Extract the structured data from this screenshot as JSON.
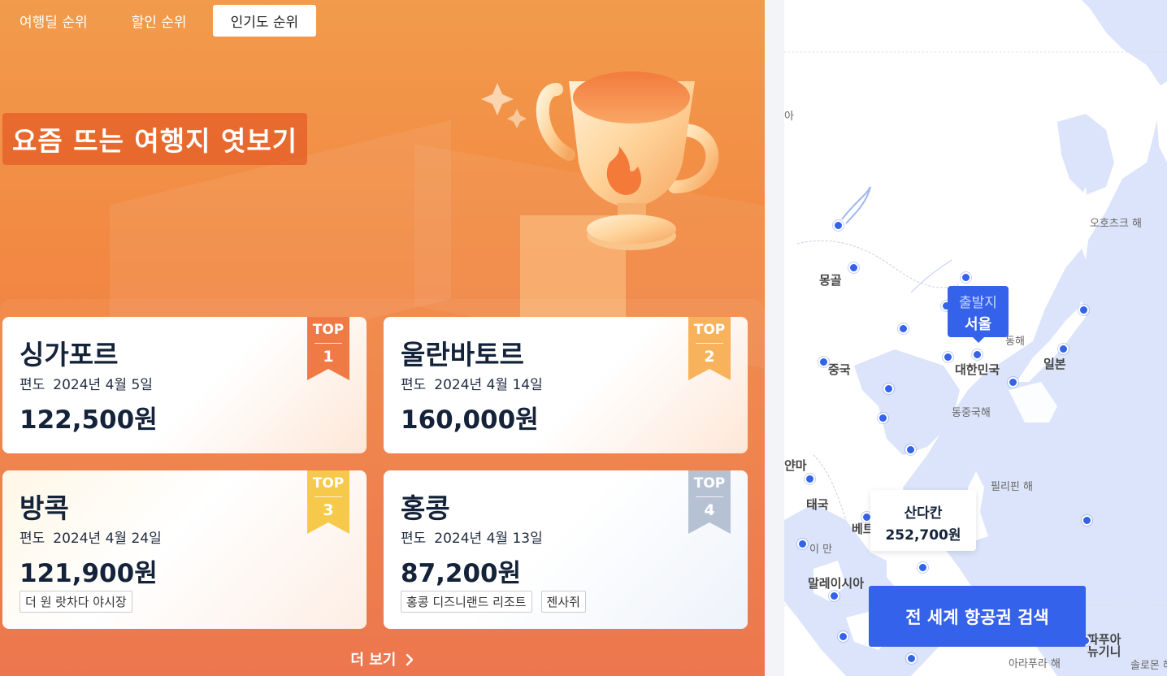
{
  "tabs": [
    {
      "label": "여행딜 순위",
      "active": false
    },
    {
      "label": "할인 순위",
      "active": false
    },
    {
      "label": "인기도 순위",
      "active": true
    }
  ],
  "headline": "요즘 뜨는 여행지 엿보기",
  "cards": [
    {
      "city": "싱가포르",
      "trip_type": "편도",
      "date": "2024년 4월 5일",
      "price": "122,500원",
      "rank_label": "TOP",
      "rank": "1",
      "tags": []
    },
    {
      "city": "울란바토르",
      "trip_type": "편도",
      "date": "2024년 4월 14일",
      "price": "160,000원",
      "rank_label": "TOP",
      "rank": "2",
      "tags": []
    },
    {
      "city": "방콕",
      "trip_type": "편도",
      "date": "2024년 4월 24일",
      "price": "121,900원",
      "rank_label": "TOP",
      "rank": "3",
      "tags": [
        "더 원 랏차다 야시장"
      ]
    },
    {
      "city": "홍콩",
      "trip_type": "편도",
      "date": "2024년 4월 13일",
      "price": "87,200원",
      "rank_label": "TOP",
      "rank": "4",
      "tags": [
        "홍콩 디즈니랜드 리조트",
        "젠사쥐"
      ]
    }
  ],
  "ribbon_colors": [
    "#f07a45",
    "#f7b25b",
    "#f7c94a",
    "#b6c2d3"
  ],
  "more_label": "더 보기",
  "map": {
    "labels": [
      {
        "text": "아",
        "kind": "edge"
      },
      {
        "text": "오호츠크 해",
        "kind": "sea"
      },
      {
        "text": "몽골",
        "kind": "country"
      },
      {
        "text": "동해",
        "kind": "sea"
      },
      {
        "text": "일본",
        "kind": "country"
      },
      {
        "text": "중국",
        "kind": "country"
      },
      {
        "text": "대한민국",
        "kind": "country"
      },
      {
        "text": "동중국해",
        "kind": "sea"
      },
      {
        "text": "필리핀 해",
        "kind": "sea"
      },
      {
        "text": "얀마",
        "kind": "edge"
      },
      {
        "text": "태국",
        "kind": "country"
      },
      {
        "text": "베트",
        "kind": "country"
      },
      {
        "text": "이 만",
        "kind": "sea"
      },
      {
        "text": "말레이시아",
        "kind": "country"
      },
      {
        "text": "아라푸라 해",
        "kind": "sea"
      },
      {
        "text": "파푸아\n뉴기니",
        "kind": "country"
      },
      {
        "text": "솔로몬 해",
        "kind": "sea"
      }
    ],
    "origin": {
      "caption": "출발지",
      "city": "서울"
    },
    "popup": {
      "city": "산다칸",
      "price": "252,700원"
    },
    "search_button": "전 세계 항공권 검색"
  }
}
